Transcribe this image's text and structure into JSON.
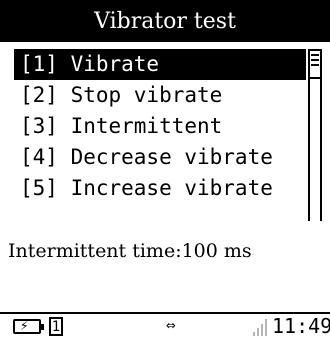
{
  "window": {
    "title": "Vibrator test"
  },
  "menu": {
    "items": [
      {
        "label": "[1] Vibrate",
        "selected": true
      },
      {
        "label": "[2] Stop vibrate",
        "selected": false
      },
      {
        "label": "[3] Intermittent",
        "selected": false
      },
      {
        "label": "[4] Decrease vibrate",
        "selected": false
      },
      {
        "label": "[5] Increase vibrate",
        "selected": false
      }
    ]
  },
  "info": {
    "intermittent_time": "Intermittent time:100 ms"
  },
  "statusbar": {
    "battery_icon": "battery-charging-icon",
    "sim_slot": "1",
    "usb_icon": "usb-icon",
    "usb_glyph": "⇔",
    "signal_icon": "signal-strength-icon",
    "time": "11:49"
  },
  "colors": {
    "background": "#ffffff",
    "foreground": "#000000",
    "signal_inactive": "#b5b5b5"
  }
}
